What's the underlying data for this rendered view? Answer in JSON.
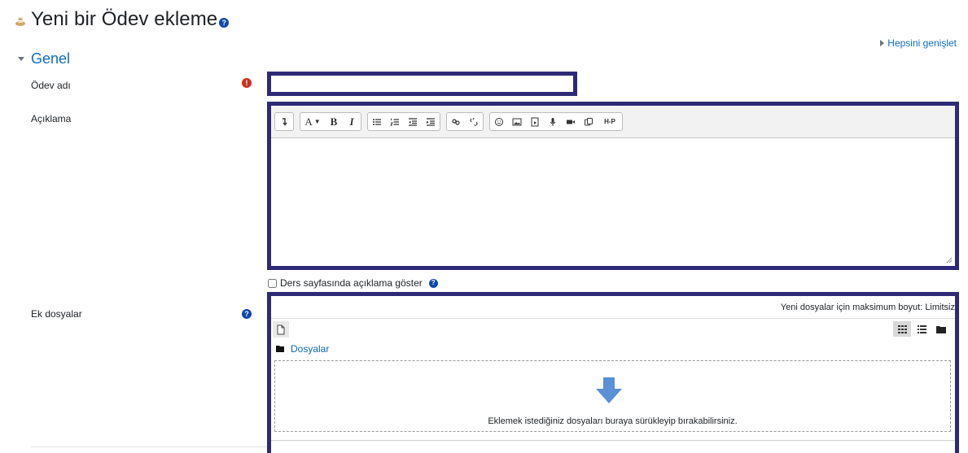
{
  "header": {
    "title": "Yeni bir Ödev ekleme",
    "module_icon": "assignment-icon",
    "help_icon": "question-circle-icon"
  },
  "expand_all_label": "Hepsini genişlet",
  "section": {
    "title": "Genel"
  },
  "fields": {
    "name": {
      "label": "Ödev adı",
      "value": "",
      "required_icon": "exclamation-circle-icon"
    },
    "description": {
      "label": "Açıklama",
      "value": ""
    },
    "show_description": {
      "label": "Ders sayfasında açıklama göster",
      "checked": false
    },
    "attachments": {
      "label": "Ek dosyalar"
    }
  },
  "editor_toolbar": {
    "groups": [
      [
        "collapse-icon"
      ],
      [
        "font-style-icon",
        "bold-icon",
        "italic-icon"
      ],
      [
        "unordered-list-icon",
        "ordered-list-icon",
        "outdent-icon",
        "indent-icon"
      ],
      [
        "link-icon",
        "unlink-icon"
      ],
      [
        "emoji-icon",
        "image-icon",
        "media-icon",
        "record-audio-icon",
        "record-video-icon",
        "manage-files-icon",
        "h5p-icon"
      ]
    ],
    "h5p_label": "H-P",
    "font_label": "A",
    "bold_label": "B",
    "italic_label": "I"
  },
  "filemanager": {
    "max_size": "Yeni dosyalar için maksimum boyut: Limitsiz",
    "folder_label": "Dosyalar",
    "drop_text": "Eklemek istediğiniz dosyaları buraya sürükleyip bırakabilirsiniz.",
    "views": [
      "icons-view-icon",
      "list-view-icon",
      "tree-view-icon"
    ]
  },
  "colors": {
    "highlight_border": "#2e2a78",
    "link": "#0f6cbf",
    "required": "#ca3120",
    "help": "#0f47ad",
    "drop_arrow": "#5b8fd6"
  }
}
